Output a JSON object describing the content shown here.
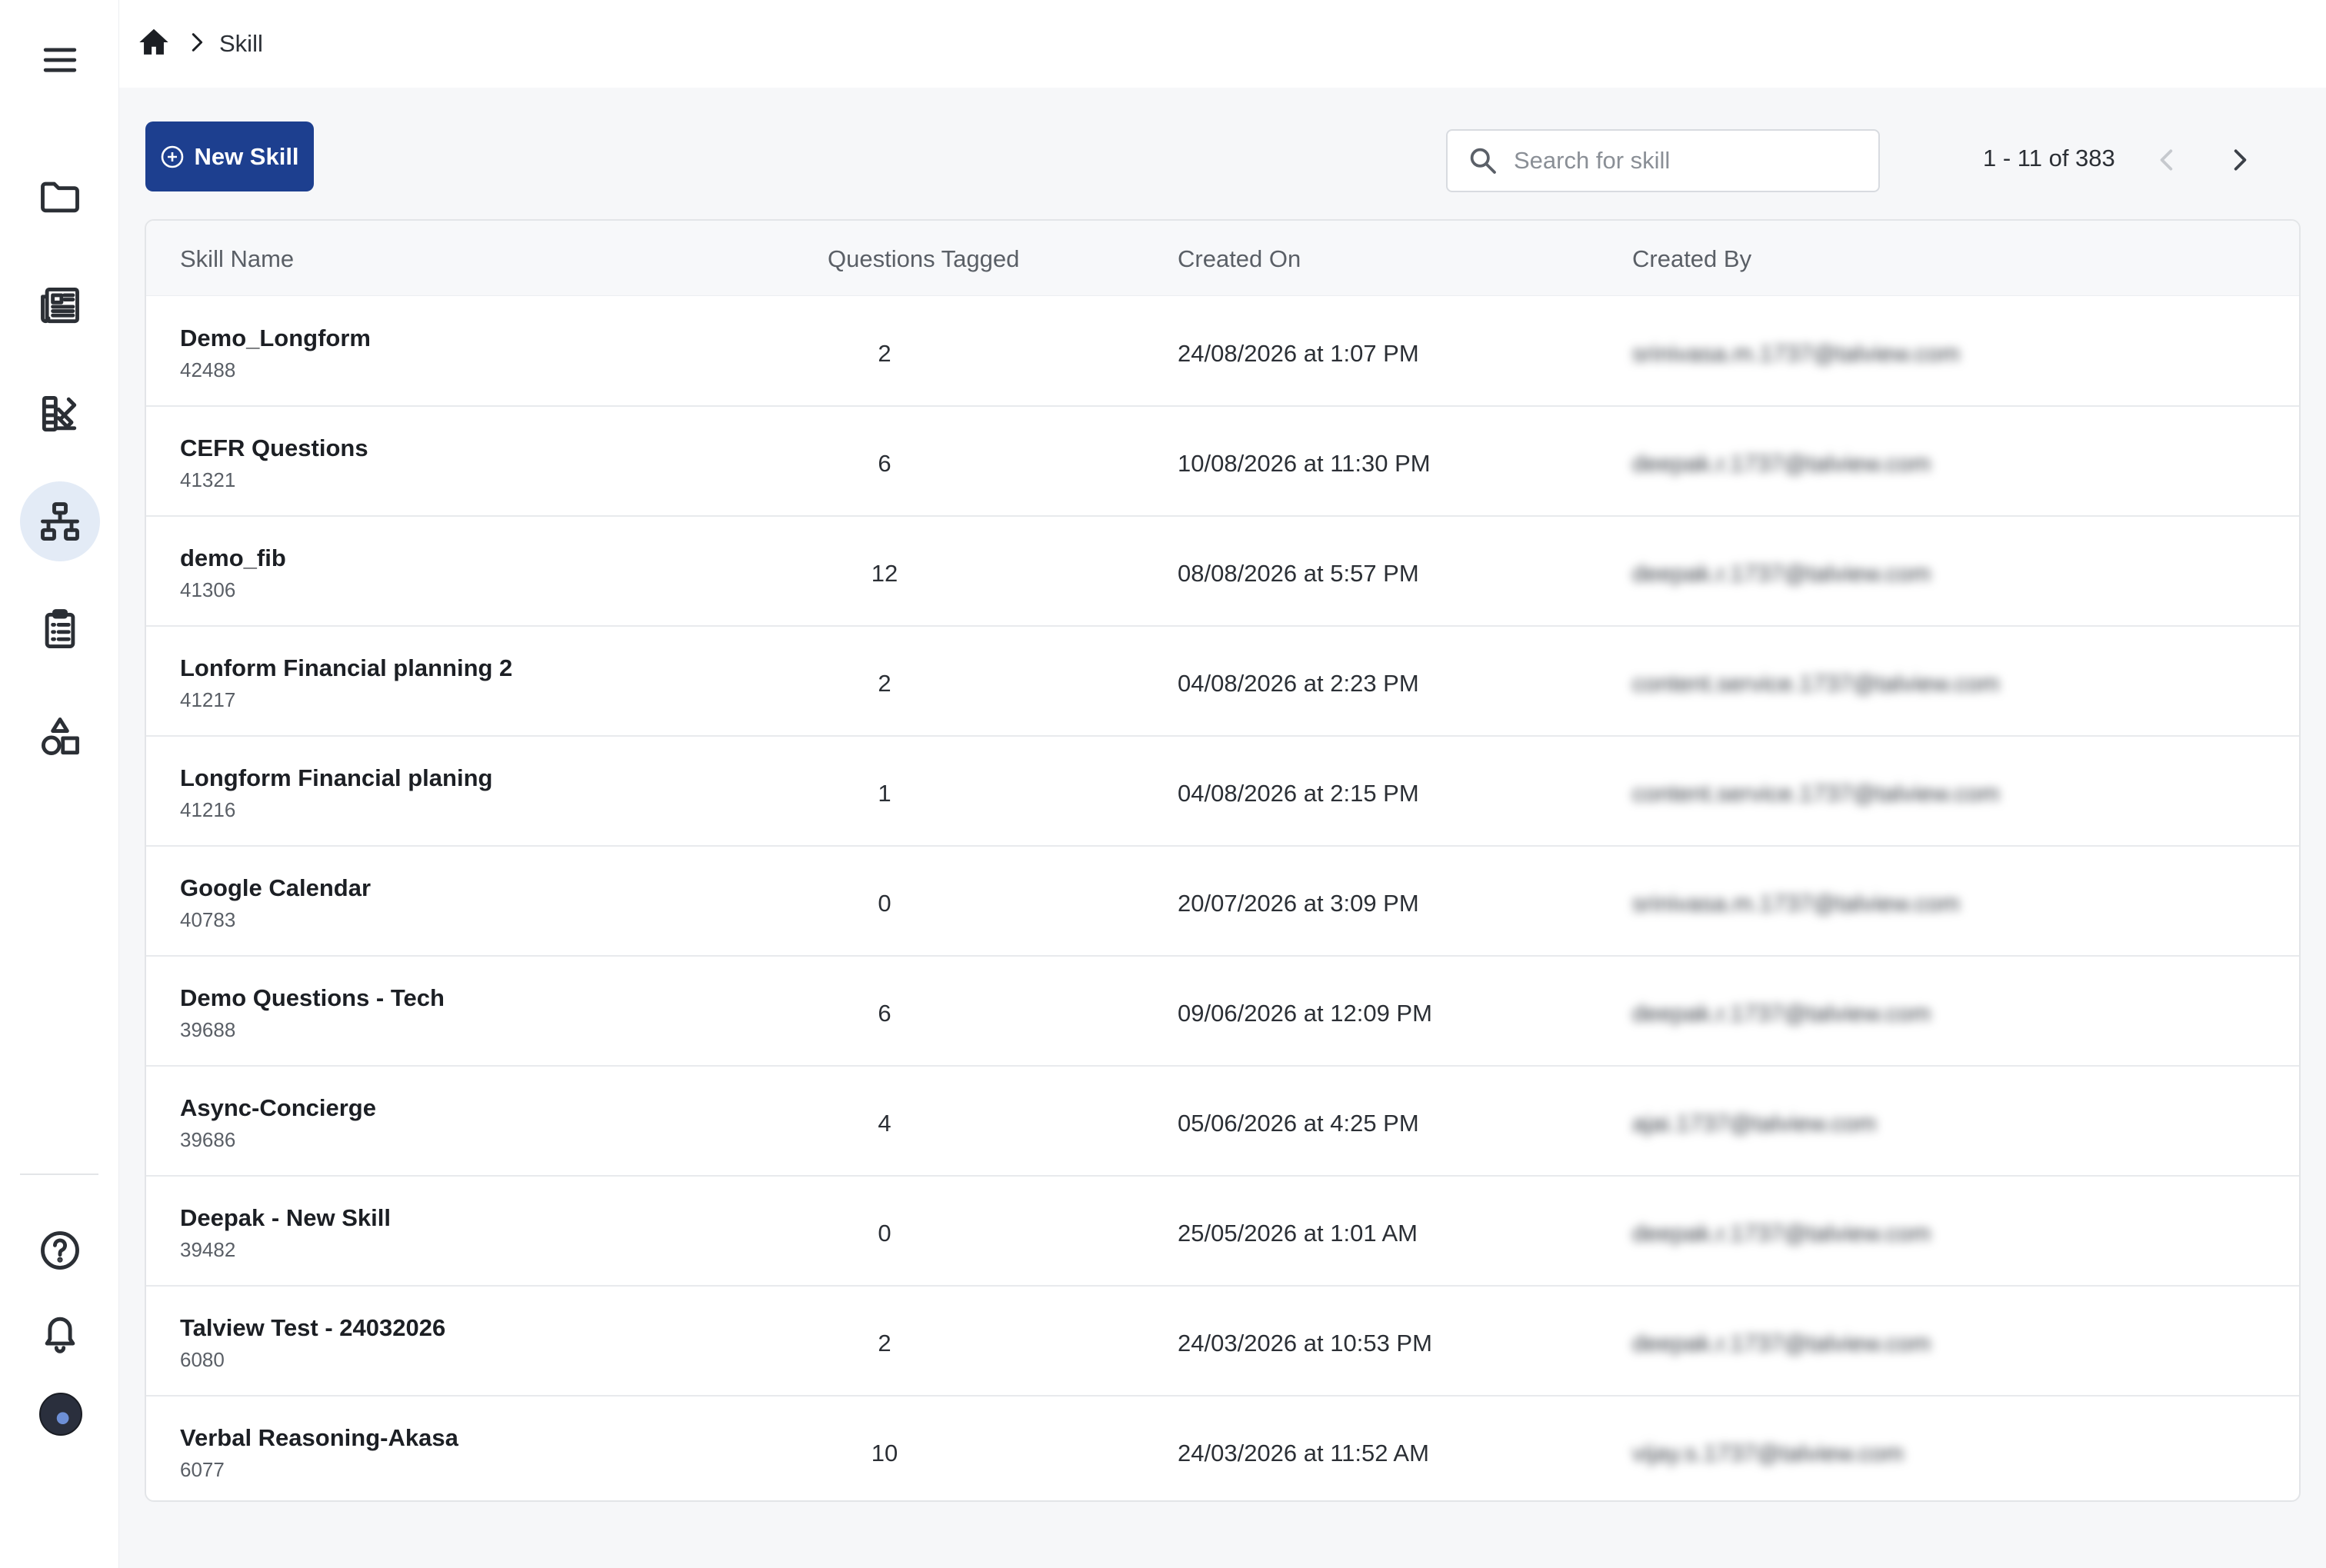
{
  "breadcrumb": {
    "current": "Skill"
  },
  "toolbar": {
    "new_label": "New Skill",
    "search_placeholder": "Search for skill",
    "pagination": "1 - 11 of 383"
  },
  "table": {
    "headers": [
      "Skill Name",
      "Questions Tagged",
      "Created On",
      "Created By"
    ],
    "rows": [
      {
        "name": "Demo_Longform",
        "id": "42488",
        "questions": "2",
        "created_on": "24/08/2026 at 1:07 PM",
        "created_by": "srinivasa.m.1737@talview.com"
      },
      {
        "name": "CEFR Questions",
        "id": "41321",
        "questions": "6",
        "created_on": "10/08/2026 at 11:30 PM",
        "created_by": "deepak.r.1737@talview.com"
      },
      {
        "name": "demo_fib",
        "id": "41306",
        "questions": "12",
        "created_on": "08/08/2026 at 5:57 PM",
        "created_by": "deepak.r.1737@talview.com"
      },
      {
        "name": "Lonform Financial planning 2",
        "id": "41217",
        "questions": "2",
        "created_on": "04/08/2026 at 2:23 PM",
        "created_by": "content.service.1737@talview.com"
      },
      {
        "name": "Longform Financial planing",
        "id": "41216",
        "questions": "1",
        "created_on": "04/08/2026 at 2:15 PM",
        "created_by": "content.service.1737@talview.com"
      },
      {
        "name": "Google Calendar",
        "id": "40783",
        "questions": "0",
        "created_on": "20/07/2026 at 3:09 PM",
        "created_by": "srinivasa.m.1737@talview.com"
      },
      {
        "name": "Demo Questions - Tech",
        "id": "39688",
        "questions": "6",
        "created_on": "09/06/2026 at 12:09 PM",
        "created_by": "deepak.r.1737@talview.com"
      },
      {
        "name": "Async-Concierge",
        "id": "39686",
        "questions": "4",
        "created_on": "05/06/2026 at 4:25 PM",
        "created_by": "ajai.1737@talview.com"
      },
      {
        "name": "Deepak - New Skill",
        "id": "39482",
        "questions": "0",
        "created_on": "25/05/2026 at 1:01 AM",
        "created_by": "deepak.r.1737@talview.com"
      },
      {
        "name": "Talview Test - 24032026",
        "id": "6080",
        "questions": "2",
        "created_on": "24/03/2026 at 10:53 PM",
        "created_by": "deepak.r.1737@talview.com"
      },
      {
        "name": "Verbal Reasoning-Akasa",
        "id": "6077",
        "questions": "10",
        "created_on": "24/03/2026 at 11:52 AM",
        "created_by": "vijay.s.1737@talview.com"
      }
    ]
  },
  "sidebar": {
    "icons": [
      "menu-icon",
      "folder-icon",
      "newspaper-icon",
      "design-icon",
      "hierarchy-icon",
      "clipboard-list-icon",
      "shapes-icon",
      "help-icon",
      "bell-icon"
    ],
    "active": "hierarchy-icon"
  },
  "colors": {
    "primary": "#1d3f8f",
    "active_bg": "#e3ebf6"
  }
}
